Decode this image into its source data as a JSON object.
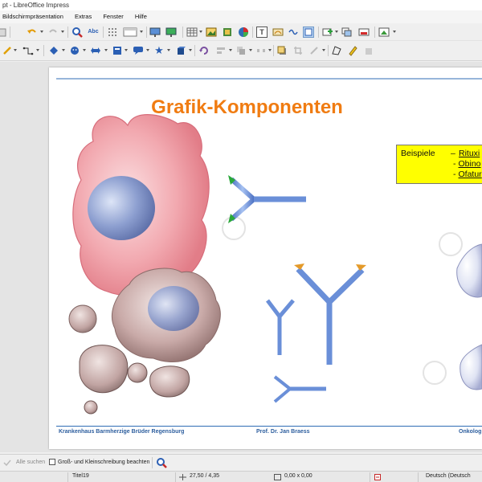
{
  "window": {
    "title": "pt - LibreOffice Impress"
  },
  "menu": [
    "Bildschirmpräsentation",
    "Extras",
    "Fenster",
    "Hilfe"
  ],
  "toolbar_icons_row1": [
    "paste-icon",
    "undo-icon",
    "redo-icon",
    "find-replace-icon",
    "spellcheck-icon",
    "grid-icon",
    "display-views-icon",
    "start-slideshow-icon",
    "slideshow-current-icon",
    "table-icon",
    "image-icon",
    "media-icon",
    "chart-icon",
    "textbox-icon",
    "fontwork-icon",
    "special-character-icon",
    "show-draw-functions-icon",
    "new-slide-icon",
    "duplicate-slide-icon",
    "delete-slide-icon",
    "slide-layout-icon"
  ],
  "toolbar_icons_row2": [
    "line-color-icon",
    "connector-icon",
    "basic-shapes-icon",
    "symbol-shapes-icon",
    "block-arrows-icon",
    "flowchart-icon",
    "callout-icon",
    "stars-icon",
    "3d-objects-icon",
    "rotate-icon",
    "align-icon",
    "arrange-icon",
    "distribute-icon",
    "shadow-icon",
    "crop-icon",
    "filter-icon",
    "points-icon",
    "glue-points-icon",
    "toggle-extrusion-icon"
  ],
  "slide": {
    "title": "Grafik-Komponenten",
    "callout": {
      "label": "Beispiele",
      "dash": "–",
      "items": [
        "Rituxi",
        "Obino",
        "Ofatur"
      ],
      "bullet": "-"
    },
    "footer_left": "Krankenhaus Barmherzige Brüder Regensburg",
    "footer_center": "Prof. Dr. Jan Braess",
    "footer_right": "Onkolog"
  },
  "findbar": {
    "find_all": "Alle suchen",
    "match_case": "Groß- und Kleinschreibung beachten"
  },
  "statusbar": {
    "slide_name": "Titel19",
    "position": "27,50 / 4,35",
    "size": "0,00 x 0,00",
    "language": "Deutsch (Deutsch"
  },
  "colors": {
    "title_orange": "#f07c12",
    "footer_blue": "#2d5e9e",
    "antibody_blue": "#6a8fd8",
    "callout_yellow": "#ffff00"
  }
}
